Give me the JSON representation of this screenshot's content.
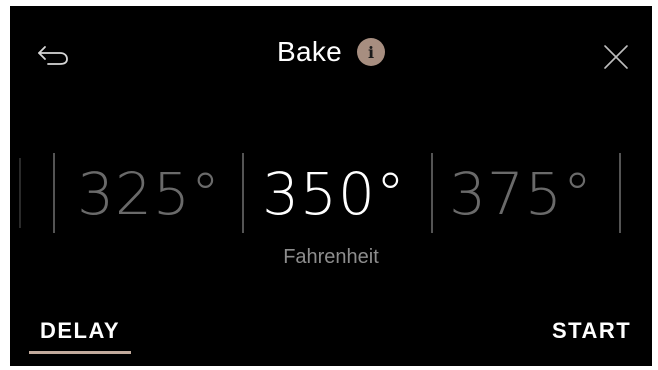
{
  "header": {
    "title": "Bake",
    "back_icon": "back-arrow-icon",
    "info_icon": "info-icon",
    "info_label": "i",
    "close_icon": "close-icon",
    "info_color": "#a78e80"
  },
  "temperature": {
    "previous": "325°",
    "selected": "350°",
    "next": "375°",
    "unit": "Fahrenheit"
  },
  "actions": {
    "delay_label": "DELAY",
    "start_label": "START",
    "accent": "#c2aa9c"
  }
}
